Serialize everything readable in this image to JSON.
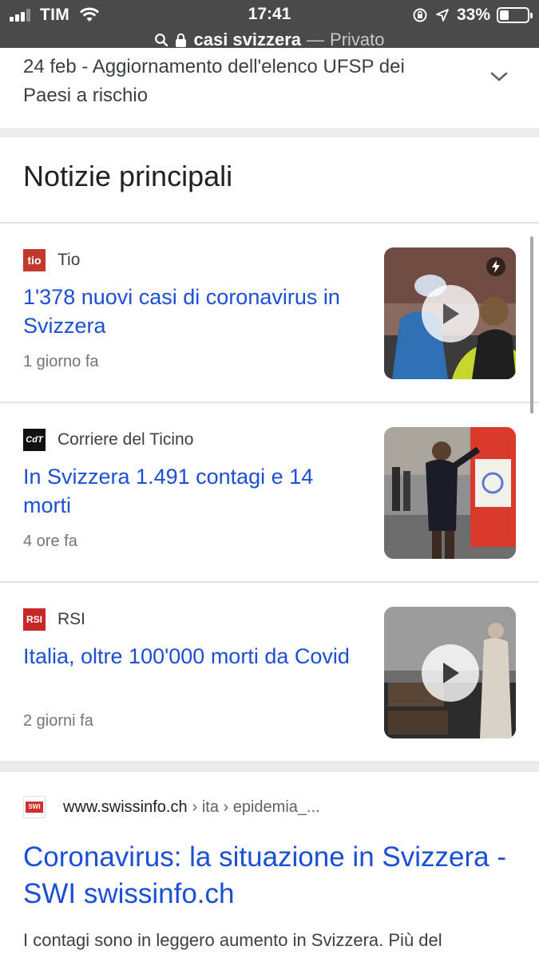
{
  "status_bar": {
    "carrier": "TIM",
    "time": "17:41",
    "battery_percent": "33%",
    "battery_level": 0.33,
    "icons": [
      "signal-icon",
      "wifi-icon",
      "orientation-lock-icon",
      "location-icon",
      "battery-icon"
    ]
  },
  "address_bar": {
    "query": "casi svizzera",
    "separator": "—",
    "mode": "Privato",
    "icons": [
      "search-icon",
      "lock-icon"
    ]
  },
  "top_card": {
    "text": "24 feb - Aggiornamento dell'elenco UFSP dei Paesi a rischio",
    "icon": "chevron-down-icon"
  },
  "top_stories": {
    "heading": "Notizie principali",
    "items": [
      {
        "source": "Tio",
        "favicon_text": "tio",
        "favicon_color": "#c0392b",
        "title": "1'378 nuovi casi di coronavirus in Svizzera",
        "time": "1 giorno fa",
        "has_video": true,
        "amp": true
      },
      {
        "source": "Corriere del Ticino",
        "favicon_text": "CdT",
        "favicon_color": "#111111",
        "title": "In Svizzera 1.491 contagi e 14 morti",
        "time": "4 ore fa",
        "has_video": false,
        "amp": false
      },
      {
        "source": "RSI",
        "favicon_text": "RSI",
        "favicon_color": "#c62828",
        "title": "Italia, oltre 100'000 morti da Covid",
        "time": "2 giorni fa",
        "has_video": true,
        "amp": false
      }
    ]
  },
  "result": {
    "favicon_text": "SWI",
    "favicon_color": "#d32f2f",
    "domain": "www.swissinfo.ch",
    "breadcrumb": "› ita › epidemia_...",
    "title": "Coronavirus: la situazione in Svizzera - SWI swissinfo.ch",
    "snippet": "I contagi sono in leggero aumento in Svizzera. Più del"
  },
  "colors": {
    "link": "#1a4fd6",
    "topbar": "#4a4a4a"
  }
}
